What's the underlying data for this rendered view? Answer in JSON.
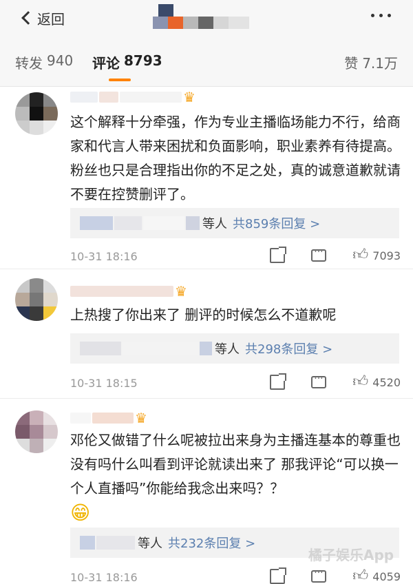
{
  "nav": {
    "back_label": "返回",
    "title_mosaic_colors": [
      "#3a4a6a",
      "#e8642a",
      "#b9b9b9",
      "#666666",
      "#d6d6d6",
      "#e3e3e3"
    ]
  },
  "tabs": {
    "reposts": {
      "label": "转发",
      "count": "940"
    },
    "comments": {
      "label": "评论",
      "count": "8793"
    },
    "likes": {
      "label": "赞",
      "count": "7.1万"
    },
    "active_indicator_color": "#ff8200"
  },
  "comments": [
    {
      "text": "这个解释十分牵强，作为专业主播临场能力不行，给商家和代言人带来困扰和负面影响，职业素养有待提高。粉丝也只是合理指出你的不足之处，真的诚意道歉就请不要在控赞删评了。",
      "reply_by": "等人",
      "reply_count": "共859条回复 >",
      "time": "10-31 18:16",
      "likes": "7093",
      "avatar_colors": [
        "#9a9a9a",
        "#222",
        "#888",
        "#bbb",
        "#111",
        "#7a6a5a",
        "#ccc",
        "#ddd",
        "#eee"
      ]
    },
    {
      "text": "上热搜了你出来了 删评的时候怎么不道歉呢",
      "reply_by": "等人",
      "reply_count": "共298条回复 >",
      "time": "10-31 18:15",
      "likes": "4520",
      "avatar_colors": [
        "#c8c8c8",
        "#8a8a8a",
        "#dcdcdc",
        "#b8a89a",
        "#777",
        "#e0d8cc",
        "#2a3550",
        "#3a3a3a",
        "#f2c83a"
      ]
    },
    {
      "text": "邓伦又做错了什么呢被拉出来身为主播连基本的尊重也没有吗什么叫看到评论就读出来了 那我评论“可以换一个人直播吗”你能给我念出来吗？？",
      "emoji": "😁",
      "reply_by": "等人",
      "reply_count": "共232条回复 >",
      "time": "10-31 18:16",
      "likes": "4059",
      "avatar_colors": [
        "#8b6a7a",
        "#c9b0b8",
        "#e8e0e2",
        "#7a5a6a",
        "#a88a98",
        "#d6c8cc",
        "#ddd",
        "#bfb0b6",
        "#eee"
      ]
    }
  ],
  "watermark": "橘子娱乐App"
}
